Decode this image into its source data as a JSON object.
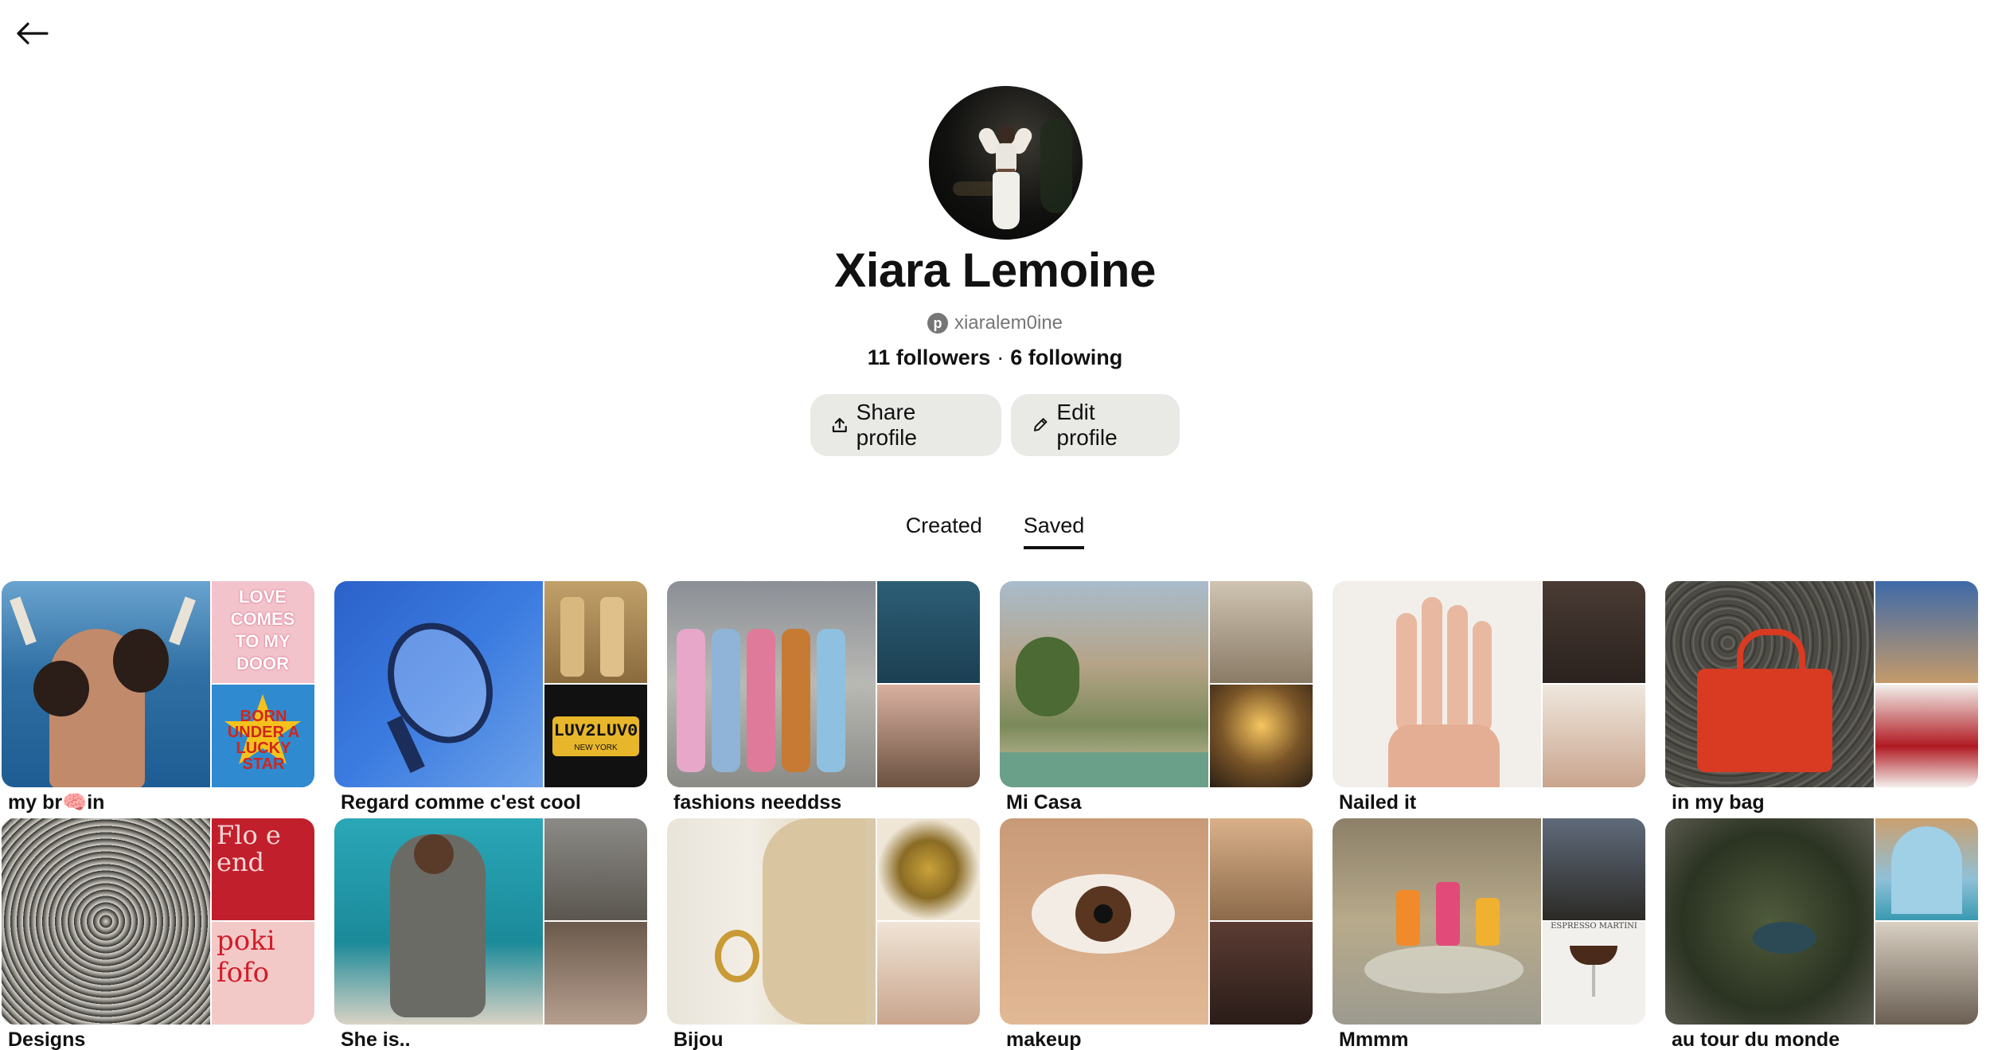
{
  "header": {
    "back_icon": "arrow-left-icon"
  },
  "profile": {
    "name": "Xiara Lemoine",
    "username": "xiaralem0ine",
    "followers": "11 followers",
    "separator": "·",
    "following": "6 following"
  },
  "actions": {
    "share_label": "Share profile",
    "share_icon": "share-upload-icon",
    "edit_label": "Edit profile",
    "edit_icon": "pencil-icon"
  },
  "tabs": [
    {
      "label": "Created",
      "active": false
    },
    {
      "label": "Saved",
      "active": true
    }
  ],
  "boards_row1": [
    {
      "title": "my br🧠in"
    },
    {
      "title": "Regard comme c'est cool"
    },
    {
      "title": "fashions needdss"
    },
    {
      "title": "Mi Casa"
    },
    {
      "title": "Nailed it"
    },
    {
      "title": "in my bag"
    }
  ],
  "boards_row2": [
    {
      "title": "Designs"
    },
    {
      "title": "She is.."
    },
    {
      "title": "Bijou"
    },
    {
      "title": "makeup"
    },
    {
      "title": "Mmmm"
    },
    {
      "title": "au tour du monde"
    }
  ],
  "collage_text": {
    "love_note": "LOVE COMES TO MY DOOR",
    "star_text": "BORN UNDER A LUCKY STAR",
    "plate": "LUV2LUV0",
    "plate_sub": "NEW YORK",
    "poster_top": "Flo e end",
    "poster_bottom": "poki fofo",
    "espresso": "ESPRESSO MARTINI"
  },
  "colors": {
    "pill_bg": "#e9e9e5",
    "text": "#111111",
    "muted": "#767676"
  }
}
